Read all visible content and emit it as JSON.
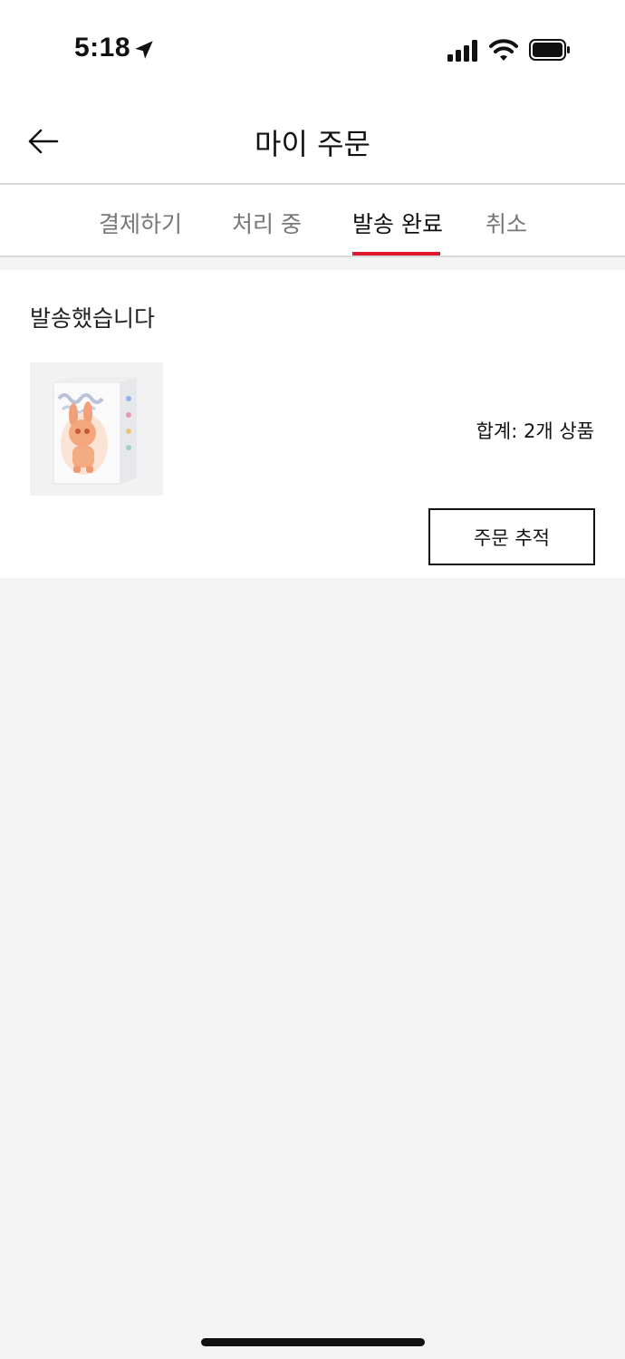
{
  "status_bar": {
    "time": "5:18"
  },
  "header": {
    "title": "마이 주문"
  },
  "tabs": [
    {
      "label": "결제하기",
      "active": false
    },
    {
      "label": "처리 중",
      "active": false
    },
    {
      "label": "발송 완료",
      "active": true
    },
    {
      "label": "취소",
      "active": false
    }
  ],
  "order": {
    "status": "발송했습니다",
    "total": "합계: 2개 상품",
    "track_label": "주문 추적",
    "product_image": "boxed figure toy product image"
  },
  "colors": {
    "accent": "#e0182d",
    "background": "#f4f4f4",
    "card": "#ffffff"
  }
}
